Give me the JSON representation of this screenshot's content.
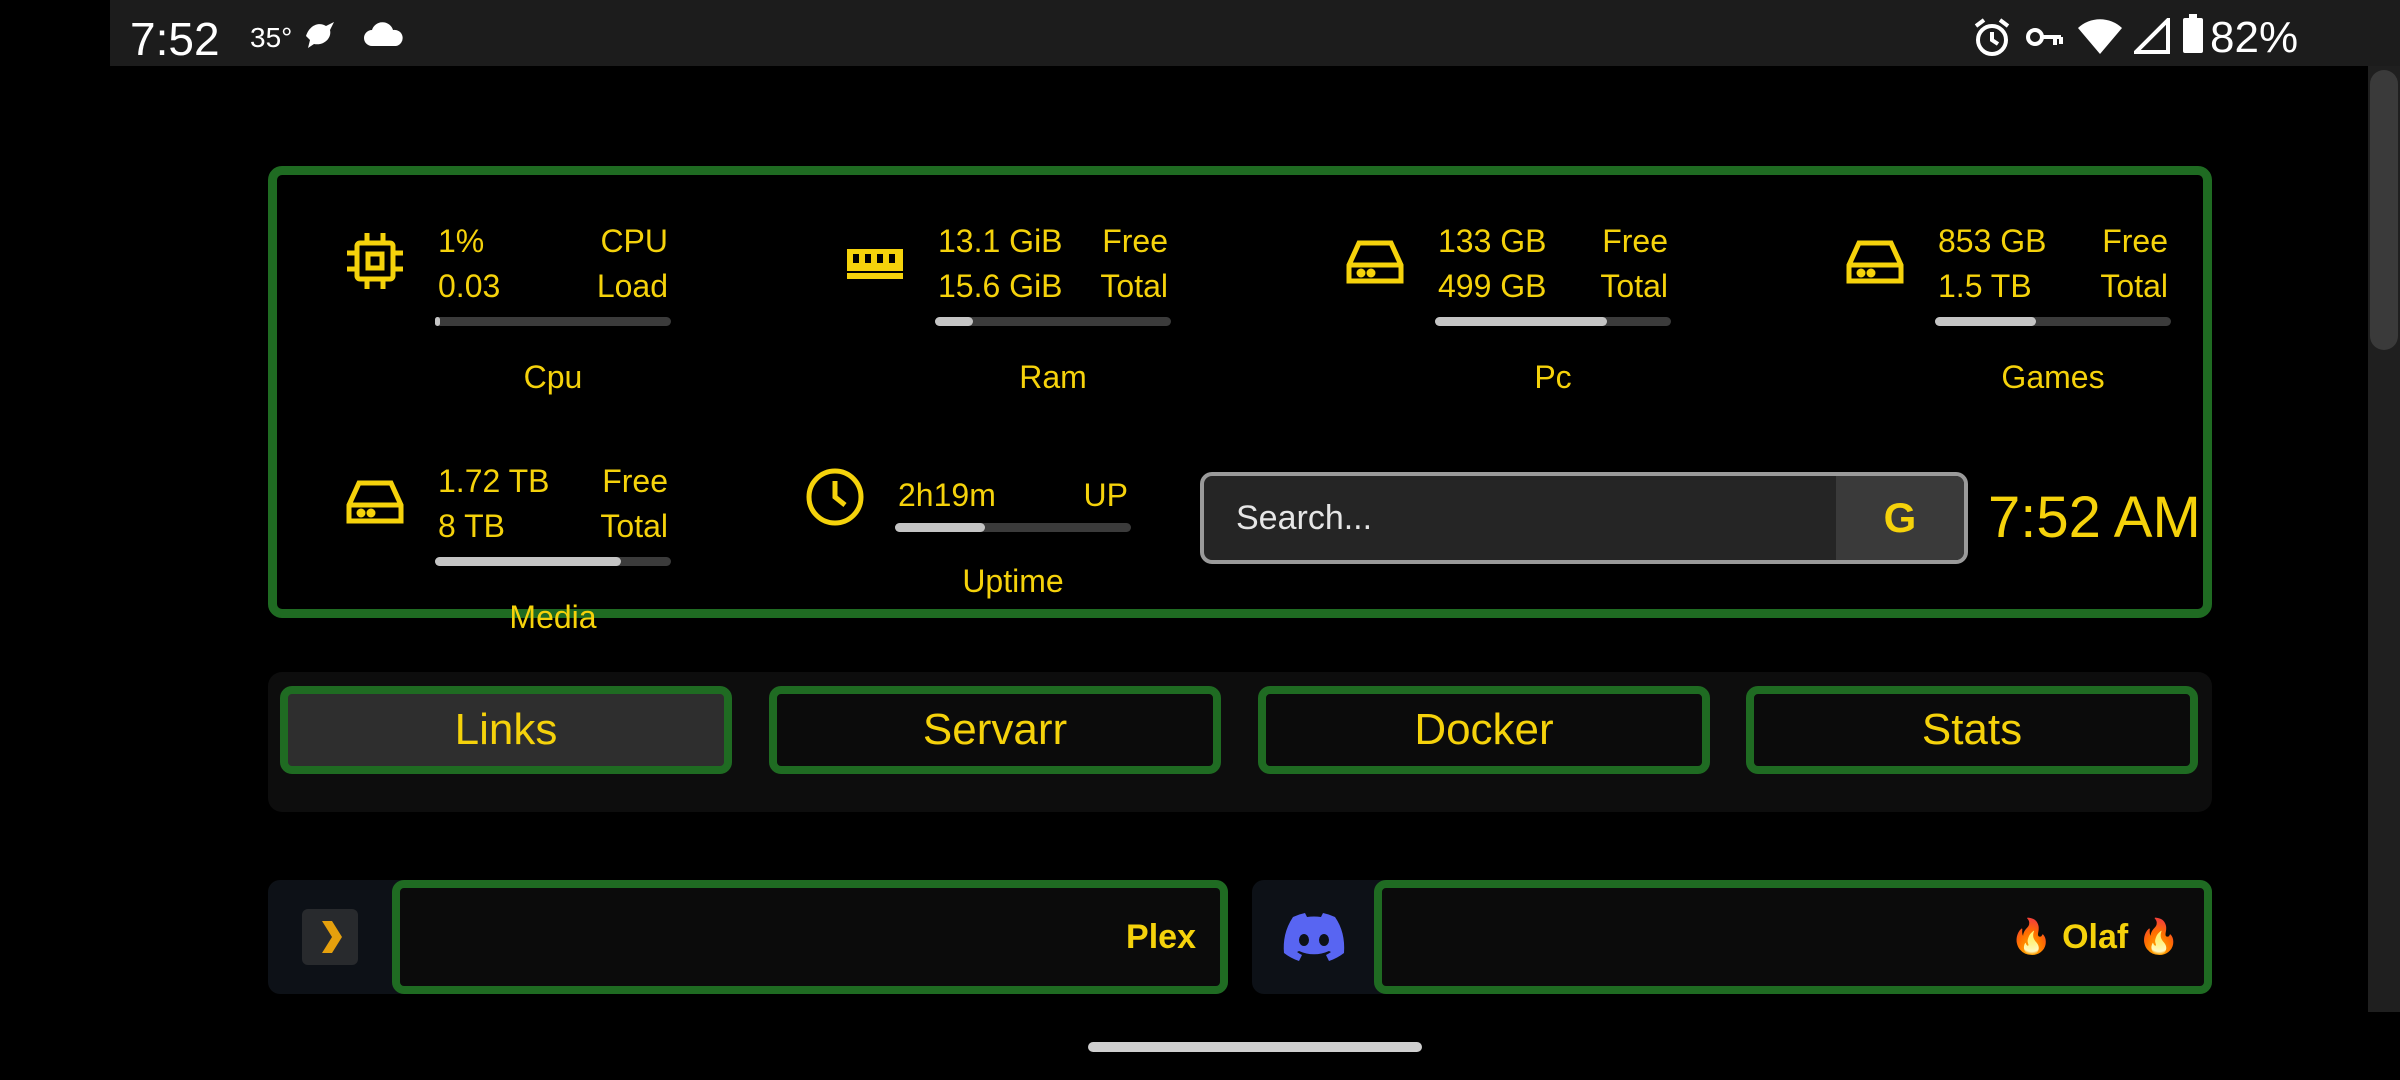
{
  "status_bar": {
    "time": "7:52",
    "temperature": "35°",
    "battery": "82%"
  },
  "stats": {
    "cpu": {
      "line1_value": "1%",
      "line1_label": "CPU",
      "line2_value": "0.03",
      "line2_label": "Load",
      "usage_fraction": 0.02,
      "caption": "Cpu"
    },
    "ram": {
      "line1_value": "13.1 GiB",
      "line1_label": "Free",
      "line2_value": "15.6 GiB",
      "line2_label": "Total",
      "usage_fraction": 0.16,
      "caption": "Ram"
    },
    "pc": {
      "line1_value": "133 GB",
      "line1_label": "Free",
      "line2_value": "499 GB",
      "line2_label": "Total",
      "usage_fraction": 0.73,
      "caption": "Pc"
    },
    "games": {
      "line1_value": "853 GB",
      "line1_label": "Free",
      "line2_value": "1.5 TB",
      "line2_label": "Total",
      "usage_fraction": 0.43,
      "caption": "Games"
    },
    "media": {
      "line1_value": "1.72 TB",
      "line1_label": "Free",
      "line2_value": "8 TB",
      "line2_label": "Total",
      "usage_fraction": 0.79,
      "caption": "Media"
    },
    "uptime": {
      "line1_value": "2h19m",
      "line1_label": "UP",
      "usage_fraction": 0.38,
      "caption": "Uptime"
    }
  },
  "search": {
    "placeholder": "Search...",
    "button_label": "G"
  },
  "clock": "7:52 AM",
  "tabs": [
    {
      "label": "Links",
      "active": true
    },
    {
      "label": "Servarr",
      "active": false
    },
    {
      "label": "Docker",
      "active": false
    },
    {
      "label": "Stats",
      "active": false
    }
  ],
  "links": [
    {
      "label": "Plex",
      "icon": "plex-icon"
    },
    {
      "label": "🔥 Olaf 🔥",
      "icon": "discord-icon"
    }
  ],
  "colors": {
    "accent_text": "#f5d20b",
    "border_green": "#1f6b22",
    "background": "#000000",
    "discord_blurple": "#5865f2"
  }
}
